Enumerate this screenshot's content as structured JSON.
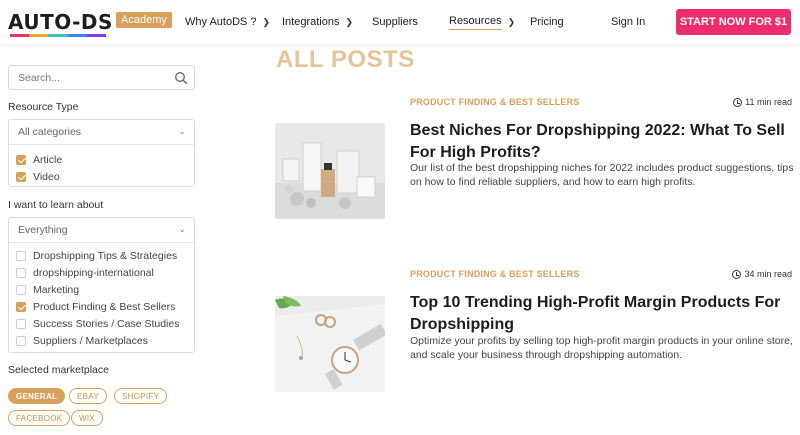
{
  "header": {
    "logo": "AUTO-DS",
    "academy_badge": "Academy",
    "nav": [
      {
        "label": "Why AutoDS ?",
        "has_dropdown": true
      },
      {
        "label": "Integrations",
        "has_dropdown": true
      },
      {
        "label": "Suppliers",
        "has_dropdown": false
      },
      {
        "label": "Resources",
        "has_dropdown": true,
        "active": true
      },
      {
        "label": "Pricing",
        "has_dropdown": false
      }
    ],
    "sign_in": "Sign In",
    "cta": "START NOW FOR $1"
  },
  "sidebar": {
    "search_placeholder": "Search...",
    "resource_type": {
      "label": "Resource Type",
      "selected": "All categories",
      "options": [
        {
          "label": "Article",
          "checked": true
        },
        {
          "label": "Video",
          "checked": true
        }
      ]
    },
    "learn_about": {
      "label": "I want to learn about",
      "selected": "Everything",
      "options": [
        {
          "label": "Dropshipping Tips & Strategies",
          "checked": false
        },
        {
          "label": "dropshipping-international",
          "checked": false
        },
        {
          "label": "Marketing",
          "checked": false
        },
        {
          "label": "Product Finding & Best Sellers",
          "checked": true
        },
        {
          "label": "Success Stories / Case Studies",
          "checked": false
        },
        {
          "label": "Suppliers / Marketplaces",
          "checked": false
        }
      ]
    },
    "marketplace": {
      "label": "Selected marketplace",
      "pills": [
        "GENERAL",
        "EBAY",
        "SHOPIFY",
        "FACEBOOK",
        "WIX"
      ],
      "active": "GENERAL"
    }
  },
  "main": {
    "heading": "ALL POSTS",
    "posts": [
      {
        "category": "PRODUCT FINDING & BEST SELLERS",
        "read_time": "11 min read",
        "title": "Best Niches For Dropshipping 2022: What To Sell For High Profits?",
        "excerpt": "Our list of the best dropshipping niches for 2022 includes product suggestions, tips on how to find reliable suppliers, and how to earn high profits."
      },
      {
        "category": "PRODUCT FINDING & BEST SELLERS",
        "read_time": "34 min read",
        "title": "Top 10 Trending High-Profit Margin Products For Dropshipping",
        "excerpt": "Optimize your profits by selling top high-profit margin products in your online store, and scale your business through dropshipping automation."
      }
    ]
  },
  "colors": {
    "accent": "#d9a05b",
    "cta": "#ee2e6c",
    "heading": "#e6c597"
  }
}
